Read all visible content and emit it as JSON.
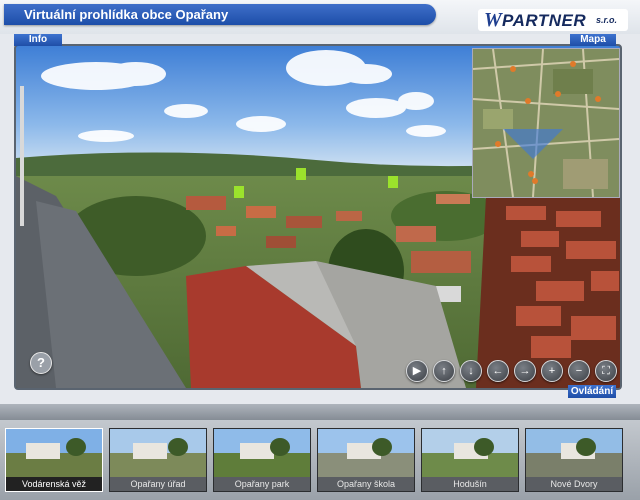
{
  "header": {
    "title": "Virtuální prohlídka obce Opařany",
    "logo_text": "PARTNER",
    "logo_suffix": "s.r.o."
  },
  "tabs": {
    "info": "Info",
    "map": "Mapa",
    "controls": "Ovládání"
  },
  "help_label": "?",
  "controls": [
    {
      "name": "play-button",
      "icon": "play-icon",
      "glyph": "▶"
    },
    {
      "name": "pan-up-button",
      "icon": "arrow-up-icon",
      "glyph": "↑"
    },
    {
      "name": "pan-down-button",
      "icon": "arrow-down-icon",
      "glyph": "↓"
    },
    {
      "name": "pan-left-button",
      "icon": "arrow-left-icon",
      "glyph": "←"
    },
    {
      "name": "pan-right-button",
      "icon": "arrow-right-icon",
      "glyph": "→"
    },
    {
      "name": "zoom-in-button",
      "icon": "plus-icon",
      "glyph": "+"
    },
    {
      "name": "zoom-out-button",
      "icon": "minus-icon",
      "glyph": "−"
    },
    {
      "name": "fullscreen-button",
      "icon": "fullscreen-icon",
      "glyph": "⛶"
    }
  ],
  "thumbnails": [
    {
      "label": "Vodárenská věž",
      "active": true
    },
    {
      "label": "Opařany úřad",
      "active": false
    },
    {
      "label": "Opařany park",
      "active": false
    },
    {
      "label": "Opařany škola",
      "active": false
    },
    {
      "label": "Hodušín",
      "active": false
    },
    {
      "label": "Nové Dvory",
      "active": false
    }
  ],
  "colors": {
    "accent": "#1f4ea7",
    "header_bg": "#dfe4ea",
    "strip_bg": "#9aa1a9"
  }
}
